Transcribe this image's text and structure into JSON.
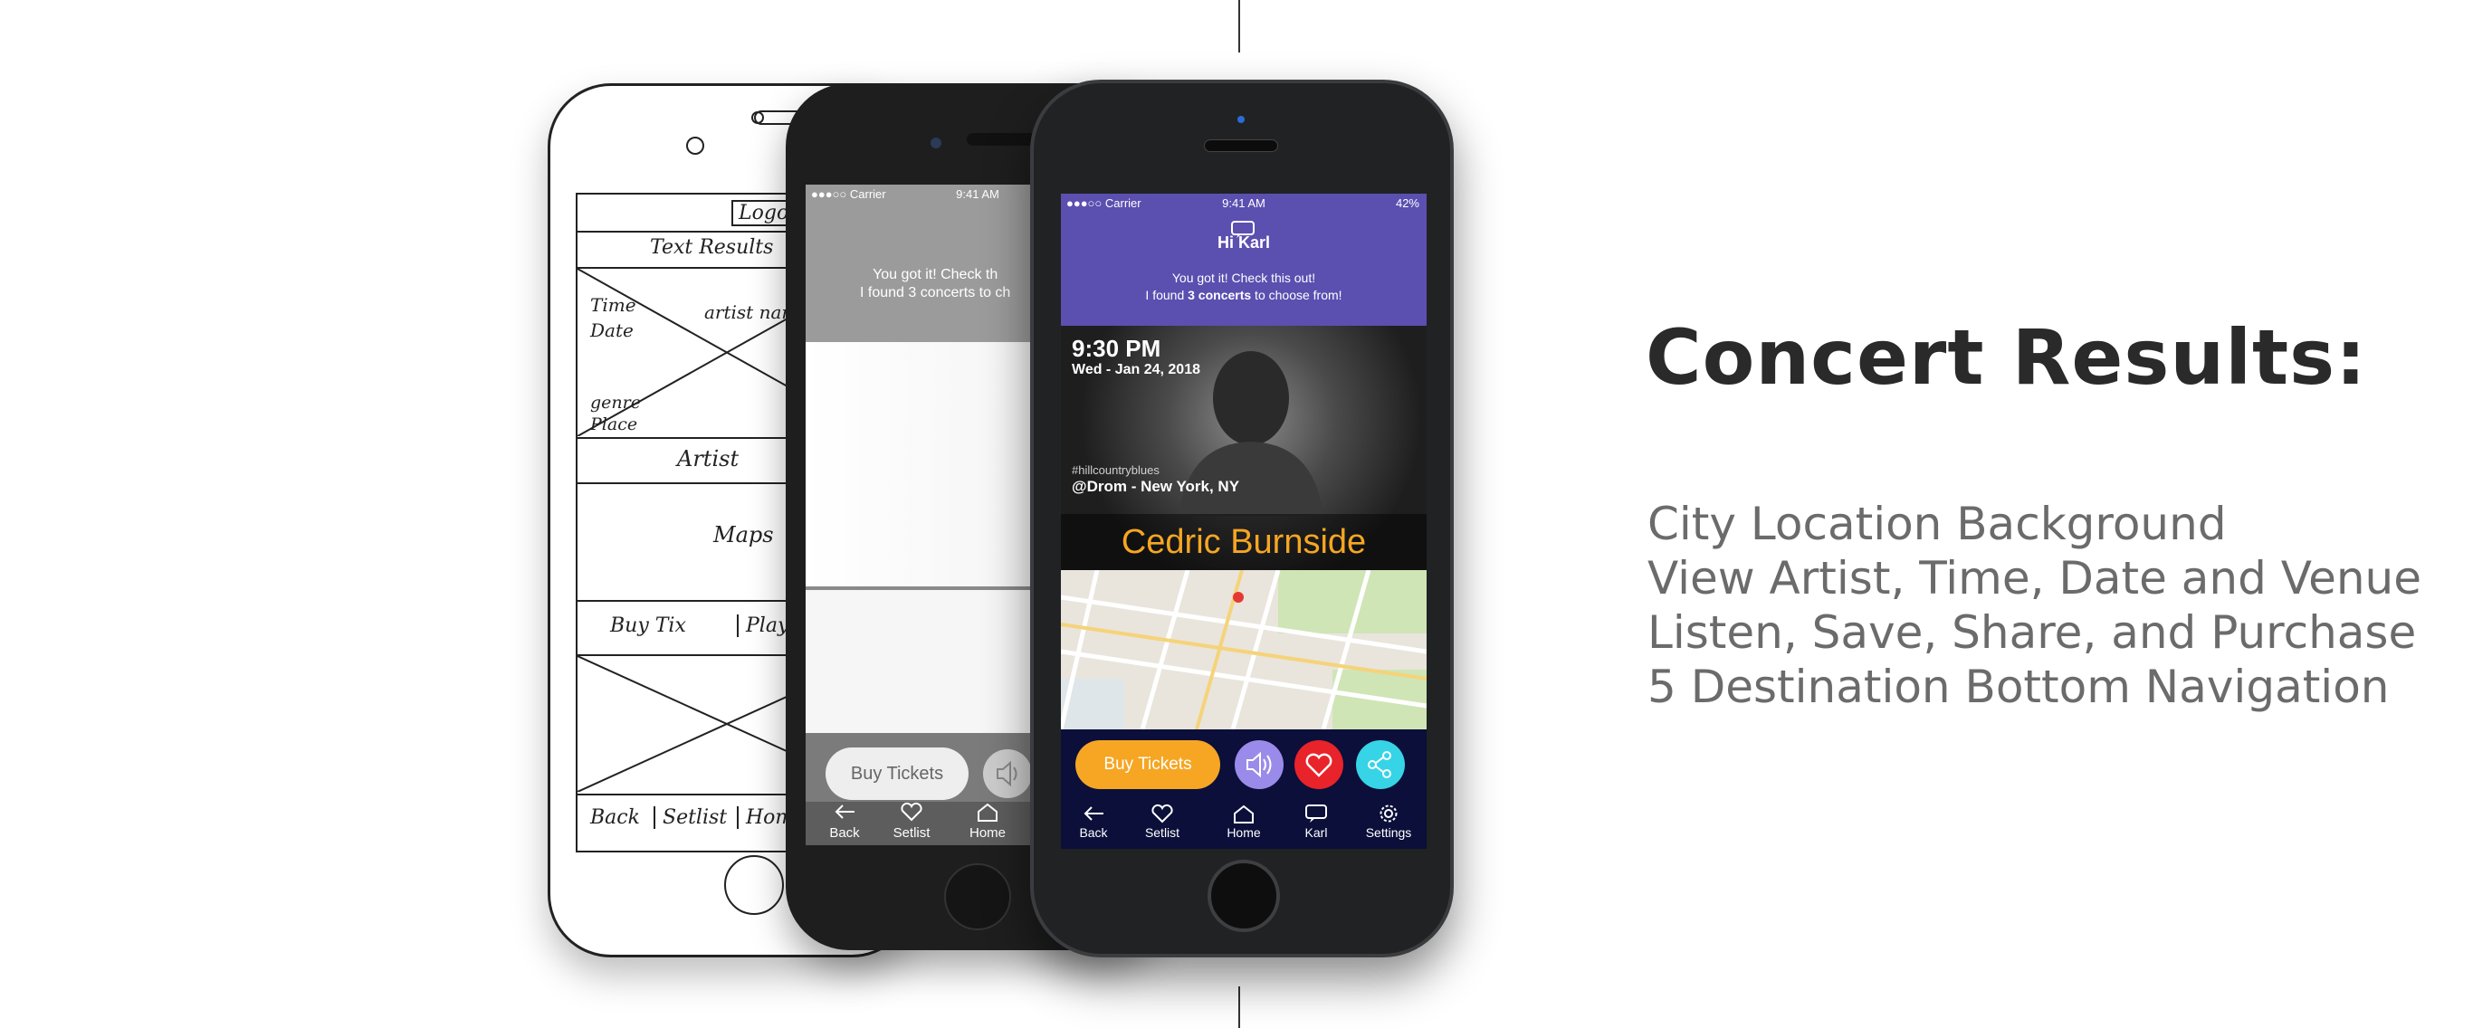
{
  "sketch": {
    "logo": "Logo",
    "text_results": "Text Results",
    "time_date": "Time Date",
    "artist_name": "artist name",
    "genre_place": "genre Place",
    "artist": "Artist",
    "maps": "Maps",
    "buy_tix": "Buy Tix",
    "play": "Play",
    "back": "Back",
    "setlist": "Setlist",
    "home": "Home"
  },
  "wireframe": {
    "carrier": "●●●○○ Carrier",
    "time": "9:41 AM",
    "message": "You got it! Check th\nI found 3 concerts to ch",
    "buy_tickets": "Buy Tickets",
    "nav": [
      "Back",
      "Setlist",
      "Home"
    ]
  },
  "app": {
    "status": {
      "carrier": "●●●○○ Carrier",
      "time": "9:41 AM",
      "battery": "42%"
    },
    "greeting": "Hi Karl",
    "message_line1": "You got it! Check this out!",
    "message_line2_pre": "I found ",
    "message_line2_bold": "3 concerts",
    "message_line2_post": " to choose from!",
    "event": {
      "time": "9:30 PM",
      "date": "Wed - Jan 24, 2018",
      "hashtag": "#hillcountryblues",
      "venue": "@Drom - New York, NY",
      "artist": "Cedric Burnside"
    },
    "buy_tickets": "Buy Tickets",
    "nav": [
      "Back",
      "Setlist",
      "Home",
      "Karl",
      "Settings"
    ],
    "colors": {
      "purple": "#5b4fb0",
      "orange": "#f6a623",
      "navy": "#0b0f3a",
      "sound": "#9a8bea",
      "heart": "#e8232a",
      "share": "#36d4e6"
    }
  },
  "panel": {
    "title": "Concert Results:",
    "features": [
      "City Location Background",
      "View Artist, Time, Date and Venue",
      "Listen, Save, Share, and Purchase",
      "5 Destination Bottom Navigation"
    ]
  }
}
